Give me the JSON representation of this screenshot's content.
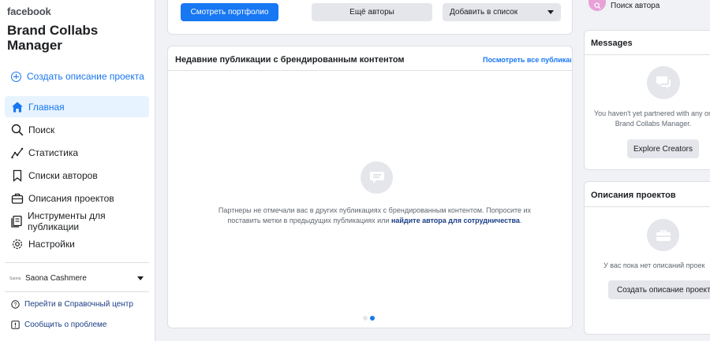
{
  "sidebar": {
    "brand": "facebook",
    "app_title": "Brand Collabs Manager",
    "create_link": "Создать описание проекта",
    "nav": [
      {
        "label": "Главная",
        "icon": "home-icon",
        "active": true
      },
      {
        "label": "Поиск",
        "icon": "search-icon",
        "active": false
      },
      {
        "label": "Статистика",
        "icon": "stats-icon",
        "active": false
      },
      {
        "label": "Списки авторов",
        "icon": "bookmark-icon",
        "active": false
      },
      {
        "label": "Описания проектов",
        "icon": "briefcase-icon",
        "active": false
      },
      {
        "label": "Инструменты для публикации",
        "icon": "publishing-tools-icon",
        "active": false
      },
      {
        "label": "Настройки",
        "icon": "gear-icon",
        "active": false
      }
    ],
    "account": {
      "logo_text": "Saona",
      "name": "Saona Cashmere"
    },
    "help_link": "Перейти в Справочный центр",
    "report_link": "Сообщить о проблеме"
  },
  "top_actions": {
    "portfolio_button": "Смотреть портфолио",
    "more_authors_button": "Ещё авторы",
    "add_to_list_select": "Добавить в список"
  },
  "recent_posts": {
    "title": "Недавние публикации с брендированным контентом",
    "see_all": "Посмотреть все публикации",
    "empty_text": "Партнеры не отмечали вас в других публикациях с брендированным контентом. Попросите их поставить метки в предыдущих публикациях или",
    "empty_link": "найдите автора для сотрудничества",
    "empty_suffix": "."
  },
  "right": {
    "search_author": "Поиск автора",
    "messages_title": "Messages",
    "messages_empty": "You haven't yet partnered with any on Brand Collabs Manager.",
    "explore_button": "Explore Creators",
    "projects_title": "Описания проектов",
    "projects_empty": "У вас пока нет описаний проек",
    "create_project_button": "Создать описание проекта"
  },
  "colors": {
    "accent": "#1877f2",
    "search_icon_bg": "#e7a2d7"
  }
}
